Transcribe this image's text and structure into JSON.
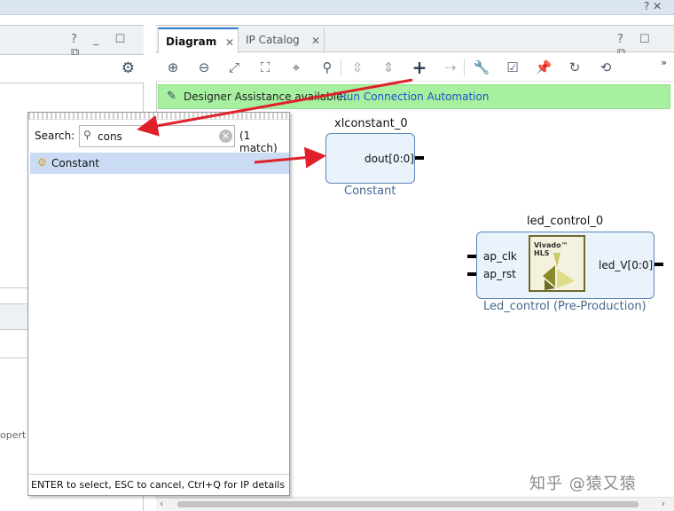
{
  "window": {
    "top_controls": "? ✕"
  },
  "left_panel": {
    "header_buttons": "? _ ☐ ⧉",
    "truncated_label": "opert"
  },
  "diagram_panel": {
    "tabs": [
      {
        "label": "Diagram",
        "close": "✕"
      },
      {
        "label": "IP Catalog",
        "close": "✕"
      }
    ],
    "header_buttons": "? ☐ ⧉",
    "toolbar_icons": [
      "zoom-in-icon",
      "zoom-out-icon",
      "fit-icon",
      "zoom-area-icon",
      "auto-center-icon",
      "search-icon",
      "collapse-icon",
      "expand-icon",
      "add-ip-icon",
      "connect-icon",
      "properties-icon",
      "validate-icon",
      "pin-icon",
      "refresh-icon",
      "regenerate-icon"
    ],
    "overflow": "»"
  },
  "assistance": {
    "text": "Designer Assistance available.",
    "link": "Run Connection Automation"
  },
  "blocks": {
    "constant": {
      "instance": "xlconstant_0",
      "port": "dout[0:0]",
      "type": "Constant"
    },
    "led_control": {
      "instance": "led_control_0",
      "inputs": [
        "ap_clk",
        "ap_rst"
      ],
      "output": "led_V[0:0]",
      "type": "Led_control (Pre-Production)",
      "logo_text": "Vivado™ HLS"
    }
  },
  "search_popup": {
    "label": "Search:",
    "query": "cons",
    "match_count": "(1 match)",
    "results": [
      "Constant"
    ],
    "footer": "ENTER to select, ESC to cancel, Ctrl+Q for IP details"
  },
  "watermark": "知乎 @猿又猿",
  "colors": {
    "assist_bg": "#a7f0a0",
    "block_bg": "#eaf2fb",
    "block_border": "#5c86b8",
    "selected_row": "#c9dcf3",
    "arrow": "#e0202a",
    "link": "#1a55c6"
  }
}
